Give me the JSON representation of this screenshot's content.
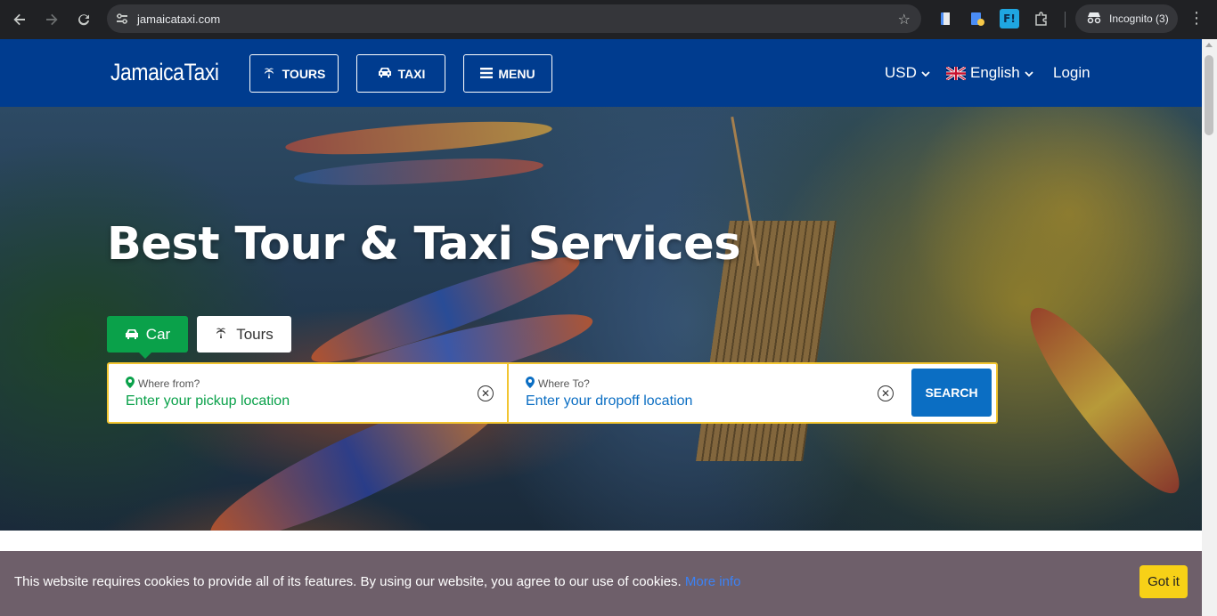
{
  "browser": {
    "url": "jamaicataxi.com",
    "incognito_label": "Incognito (3)",
    "icons": [
      "back-arrow-icon",
      "forward-arrow-icon",
      "reload-icon",
      "site-settings-icon",
      "bookmark-star-icon",
      "extension-icon",
      "puzzle-icon",
      "incognito-icon",
      "kebab-menu-icon"
    ]
  },
  "header": {
    "logo": "JamaicaTaxi",
    "tours_label": "TOURS",
    "taxi_label": "TAXI",
    "menu_label": "MENU",
    "currency": "USD",
    "language": "English",
    "login": "Login",
    "bg_color": "#003c8f"
  },
  "hero": {
    "title": "Best Tour & Taxi Services",
    "tab_car": "Car",
    "tab_tours": "Tours",
    "from_label": "Where from?",
    "from_placeholder": "Enter your pickup location",
    "to_label": "Where To?",
    "to_placeholder": "Enter your dropoff location",
    "search_label": "SEARCH",
    "accent_green": "#0aa14a",
    "accent_blue": "#0b6ec3",
    "border_yellow": "#f2c531"
  },
  "cookie": {
    "text": "This website requires cookies to provide all of its features. By using our website, you agree to our use of cookies.",
    "link": "More info",
    "button": "Got it"
  }
}
